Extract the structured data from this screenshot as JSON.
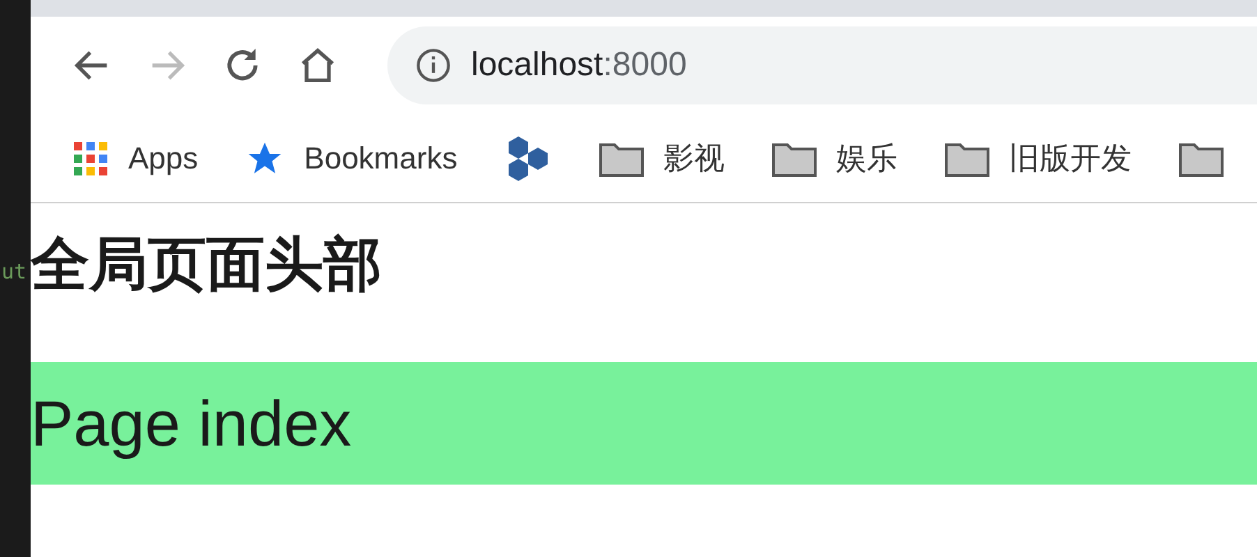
{
  "editor_fragment": {
    "text": "ut"
  },
  "toolbar": {
    "address": {
      "host": "localhost",
      "port": ":8000"
    }
  },
  "bookmarks": [
    {
      "kind": "apps",
      "label": "Apps"
    },
    {
      "kind": "star",
      "label": "Bookmarks"
    },
    {
      "kind": "hex"
    },
    {
      "kind": "folder",
      "label": "影视"
    },
    {
      "kind": "folder",
      "label": "娱乐"
    },
    {
      "kind": "folder",
      "label": "旧版开发"
    },
    {
      "kind": "folder"
    }
  ],
  "page": {
    "heading": "全局页面头部",
    "banner": "Page index"
  }
}
